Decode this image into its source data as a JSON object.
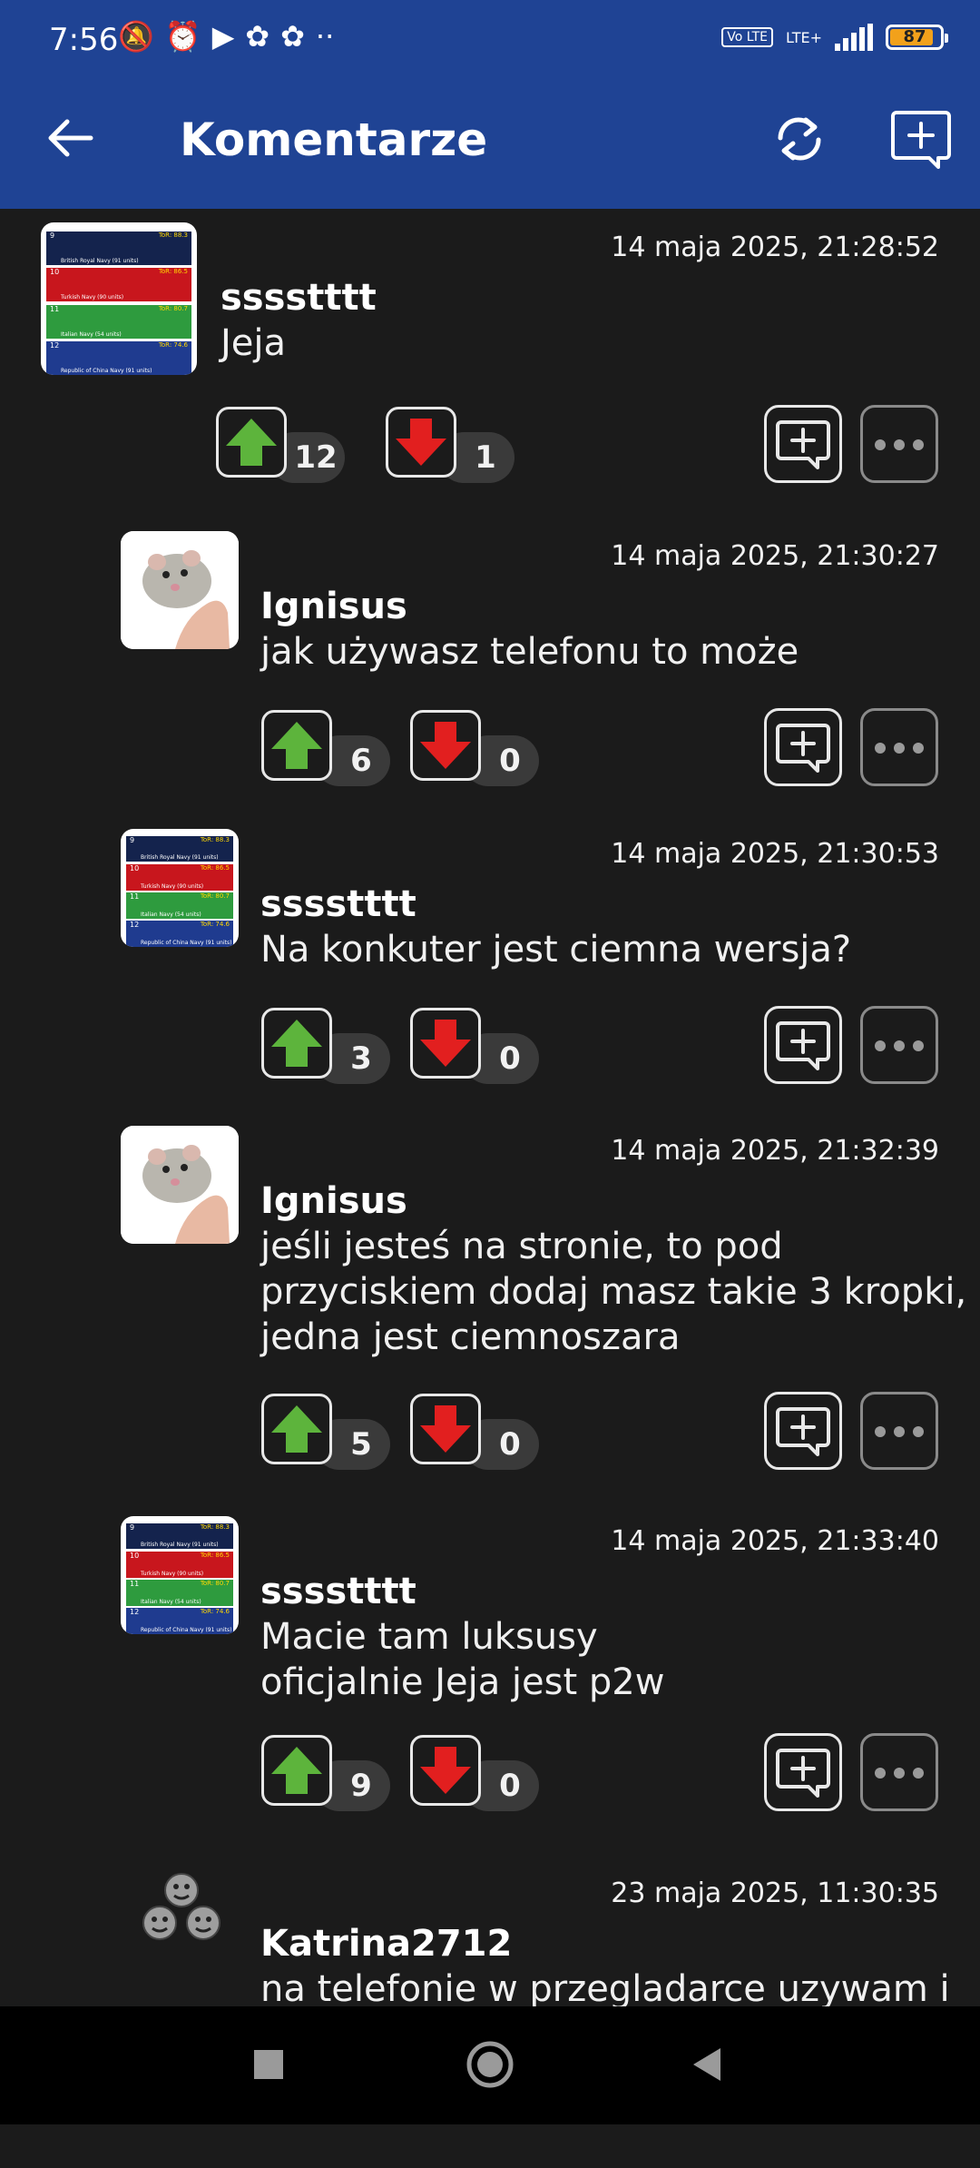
{
  "status_bar": {
    "time": "7:56",
    "battery": 87,
    "volte": "Vo LTE",
    "lte": "LTE+"
  },
  "header": {
    "title": "Komentarze"
  },
  "colors": {
    "header_bg": "#1f4394",
    "background": "#1b1b1b",
    "upvote": "#5db43c",
    "downvote": "#e21f1f",
    "battery": "#f2a11b"
  },
  "comments": [
    {
      "user": "sssstttt",
      "date": "14 maja 2025, 21:28:52",
      "text": "Jeja",
      "up": "12",
      "down": "1",
      "avatar": "flags-icon"
    },
    {
      "user": "Ignisus",
      "date": "14 maja 2025, 21:30:27",
      "text": "jak używasz telefonu to może",
      "up": "6",
      "down": "0",
      "avatar": "rat-icon"
    },
    {
      "user": "sssstttt",
      "date": "14 maja 2025, 21:30:53",
      "text": "Na konkuter jest ciemna wersja?",
      "up": "3",
      "down": "0",
      "avatar": "flags-icon"
    },
    {
      "user": "Ignisus",
      "date": "14 maja 2025, 21:32:39",
      "text": "jeśli jesteś na stronie, to pod\nprzyciskiem dodaj masz takie 3 kropki,\njedna jest ciemnoszara",
      "up": "5",
      "down": "0",
      "avatar": "rat-icon"
    },
    {
      "user": "sssstttt",
      "date": "14 maja 2025, 21:33:40",
      "text": "Macie tam luksusy\noficjalnie Jeja jest p2w",
      "up": "9",
      "down": "0",
      "avatar": "flags-icon"
    },
    {
      "user": "Katrina2712",
      "date": "23 maja 2025, 11:30:35",
      "text": "na telefonie w przegladarce uzywam i",
      "avatar": "smileys-icon"
    }
  ],
  "flag_avatar_rows": [
    {
      "rank": "9",
      "name": "British Royal Navy (91 units)",
      "score": "ToR: 88.3"
    },
    {
      "rank": "10",
      "name": "Turkish Navy (90 units)",
      "score": "ToR: 86.5"
    },
    {
      "rank": "11",
      "name": "Italian Navy (54 units)",
      "score": "ToR: 80.7"
    },
    {
      "rank": "12",
      "name": "Republic of China Navy (91 units)",
      "score": "ToR: 74.6"
    }
  ]
}
